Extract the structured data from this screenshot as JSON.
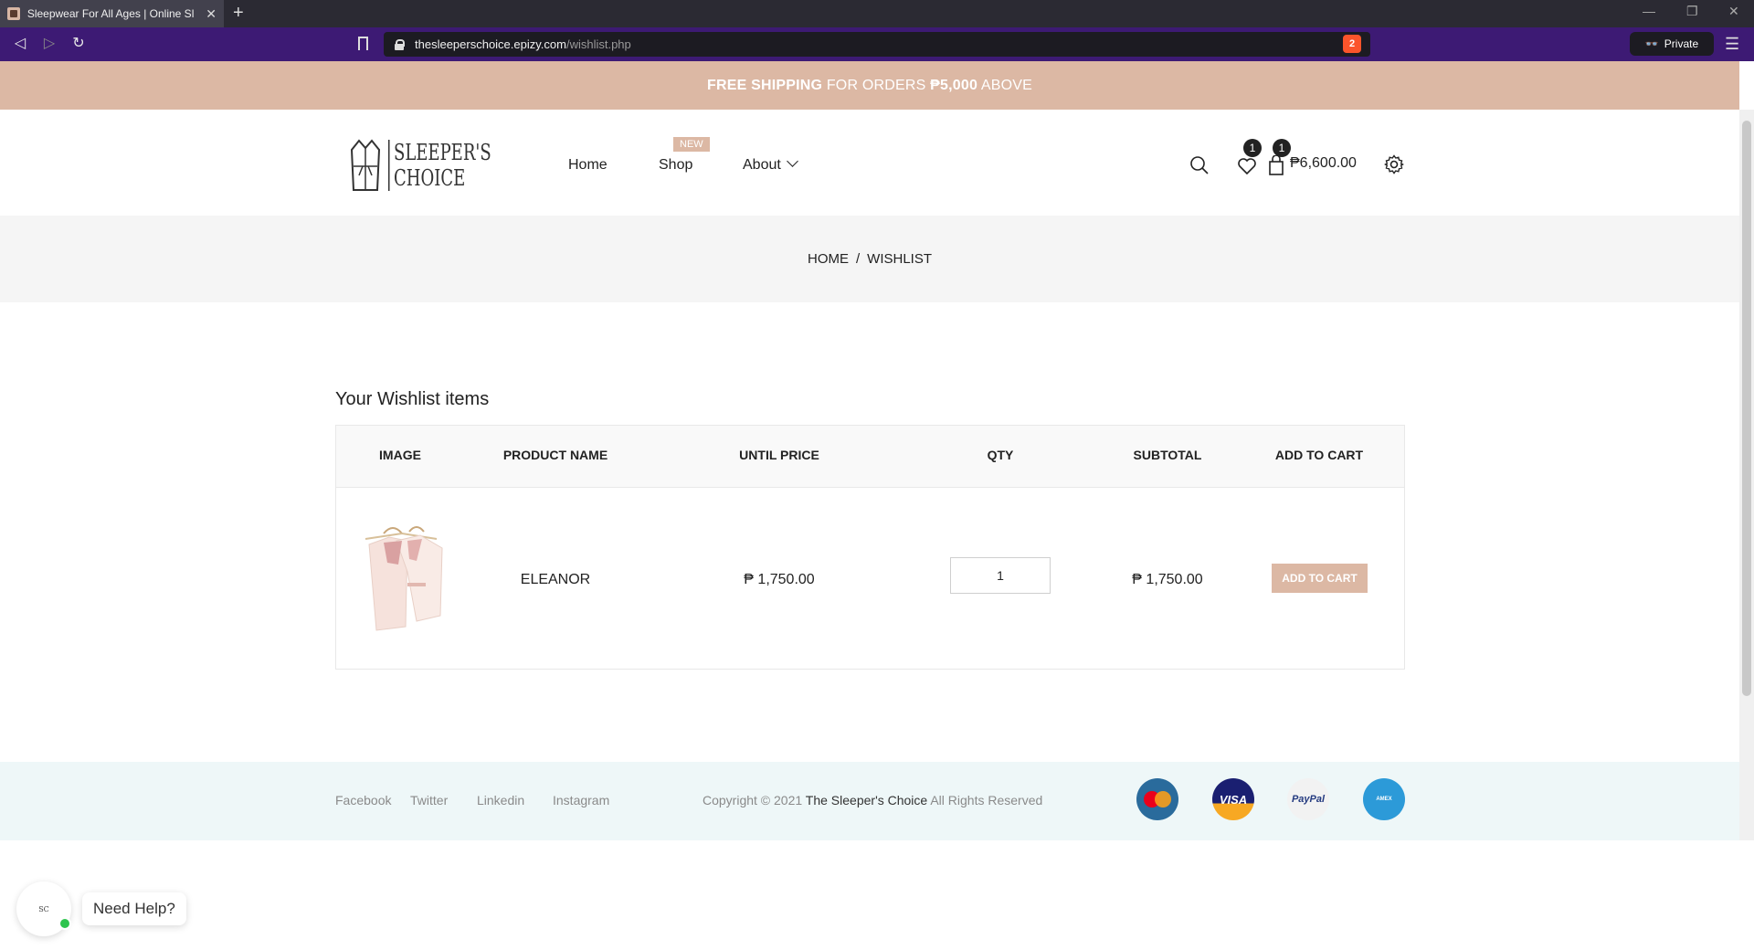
{
  "browser": {
    "tab_title": "Sleepwear For All Ages | Online Sl",
    "url_host": "thesleeperschoice.epizy.com",
    "url_path": "/wishlist.php",
    "shield_count": "2",
    "private_label": "Private"
  },
  "promo": {
    "part1": "FREE SHIPPING",
    "part2": " FOR ORDERS ",
    "part3": "₱5,000",
    "part4": " ABOVE"
  },
  "header": {
    "logo_line1": "SLEEPER'S",
    "logo_line2": "CHOICE",
    "nav": {
      "home": "Home",
      "shop": "Shop",
      "shop_badge": "NEW",
      "about": "About"
    },
    "wishlist_count": "1",
    "cart_count": "1",
    "cart_total": "₱6,600.00"
  },
  "breadcrumb": {
    "home": "HOME",
    "separator": "/",
    "current": "WISHLIST"
  },
  "wishlist": {
    "title": "Your Wishlist items",
    "columns": [
      "IMAGE",
      "PRODUCT NAME",
      "UNTIL PRICE",
      "QTY",
      "SUBTOTAL",
      "ADD TO CART"
    ],
    "rows": [
      {
        "product_name": "ELEANOR",
        "unit_price": "₱ 1,750.00",
        "qty": "1",
        "subtotal": "₱ 1,750.00",
        "button": "ADD TO CART"
      }
    ]
  },
  "footer": {
    "links": [
      "Facebook",
      "Twitter",
      "Linkedin",
      "Instagram"
    ],
    "copyright_prefix": "Copyright © 2021 ",
    "brand": "The Sleeper's Choice",
    "copyright_suffix": " All Rights Reserved",
    "payments": [
      "MasterCard",
      "VISA",
      "PayPal",
      "AMERICAN EXPRESS"
    ]
  },
  "help": {
    "label": "Need Help?"
  },
  "colors": {
    "accent": "#dcb8a4",
    "browser_nav": "#3d1a74",
    "footer_bg": "#eef7f8"
  }
}
